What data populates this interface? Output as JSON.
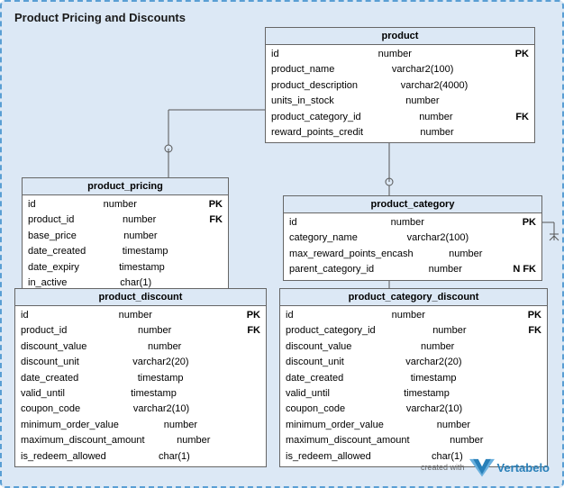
{
  "diagram": {
    "title": "Product Pricing and Discounts",
    "background_color": "#dce8f5",
    "border_color": "#5a9fd4"
  },
  "tables": {
    "product": {
      "name": "product",
      "columns": [
        {
          "name": "id",
          "type": "number",
          "key": "PK"
        },
        {
          "name": "product_name",
          "type": "varchar2(100)",
          "key": ""
        },
        {
          "name": "product_description",
          "type": "varchar2(4000)",
          "key": ""
        },
        {
          "name": "units_in_stock",
          "type": "number",
          "key": ""
        },
        {
          "name": "product_category_id",
          "type": "number",
          "key": "FK"
        },
        {
          "name": "reward_points_credit",
          "type": "number",
          "key": ""
        }
      ]
    },
    "product_pricing": {
      "name": "product_pricing",
      "columns": [
        {
          "name": "id",
          "type": "number",
          "key": "PK"
        },
        {
          "name": "product_id",
          "type": "number",
          "key": "FK"
        },
        {
          "name": "base_price",
          "type": "number",
          "key": ""
        },
        {
          "name": "date_created",
          "type": "timestamp",
          "key": ""
        },
        {
          "name": "date_expiry",
          "type": "timestamp",
          "key": ""
        },
        {
          "name": "in_active",
          "type": "char(1)",
          "key": ""
        }
      ]
    },
    "product_category": {
      "name": "product_category",
      "columns": [
        {
          "name": "id",
          "type": "number",
          "key": "PK"
        },
        {
          "name": "category_name",
          "type": "varchar2(100)",
          "key": ""
        },
        {
          "name": "max_reward_points_encash",
          "type": "number",
          "key": ""
        },
        {
          "name": "parent_category_id",
          "type": "number",
          "key": "N FK"
        }
      ]
    },
    "product_discount": {
      "name": "product_discount",
      "columns": [
        {
          "name": "id",
          "type": "number",
          "key": "PK"
        },
        {
          "name": "product_id",
          "type": "number",
          "key": "FK"
        },
        {
          "name": "discount_value",
          "type": "number",
          "key": ""
        },
        {
          "name": "discount_unit",
          "type": "varchar2(20)",
          "key": ""
        },
        {
          "name": "date_created",
          "type": "timestamp",
          "key": ""
        },
        {
          "name": "valid_until",
          "type": "timestamp",
          "key": ""
        },
        {
          "name": "coupon_code",
          "type": "varchar2(10)",
          "key": ""
        },
        {
          "name": "minimum_order_value",
          "type": "number",
          "key": ""
        },
        {
          "name": "maximum_discount_amount",
          "type": "number",
          "key": ""
        },
        {
          "name": "is_redeem_allowed",
          "type": "char(1)",
          "key": ""
        }
      ]
    },
    "product_category_discount": {
      "name": "product_category_discount",
      "columns": [
        {
          "name": "id",
          "type": "number",
          "key": "PK"
        },
        {
          "name": "product_category_id",
          "type": "number",
          "key": "FK"
        },
        {
          "name": "discount_value",
          "type": "number",
          "key": ""
        },
        {
          "name": "discount_unit",
          "type": "varchar2(20)",
          "key": ""
        },
        {
          "name": "date_created",
          "type": "timestamp",
          "key": ""
        },
        {
          "name": "valid_until",
          "type": "timestamp",
          "key": ""
        },
        {
          "name": "coupon_code",
          "type": "varchar2(10)",
          "key": ""
        },
        {
          "name": "minimum_order_value",
          "type": "number",
          "key": ""
        },
        {
          "name": "maximum_discount_amount",
          "type": "number",
          "key": ""
        },
        {
          "name": "is_redeem_allowed",
          "type": "char(1)",
          "key": ""
        }
      ]
    }
  },
  "logo": {
    "created_with": "created with",
    "brand": "Vertabelo"
  }
}
